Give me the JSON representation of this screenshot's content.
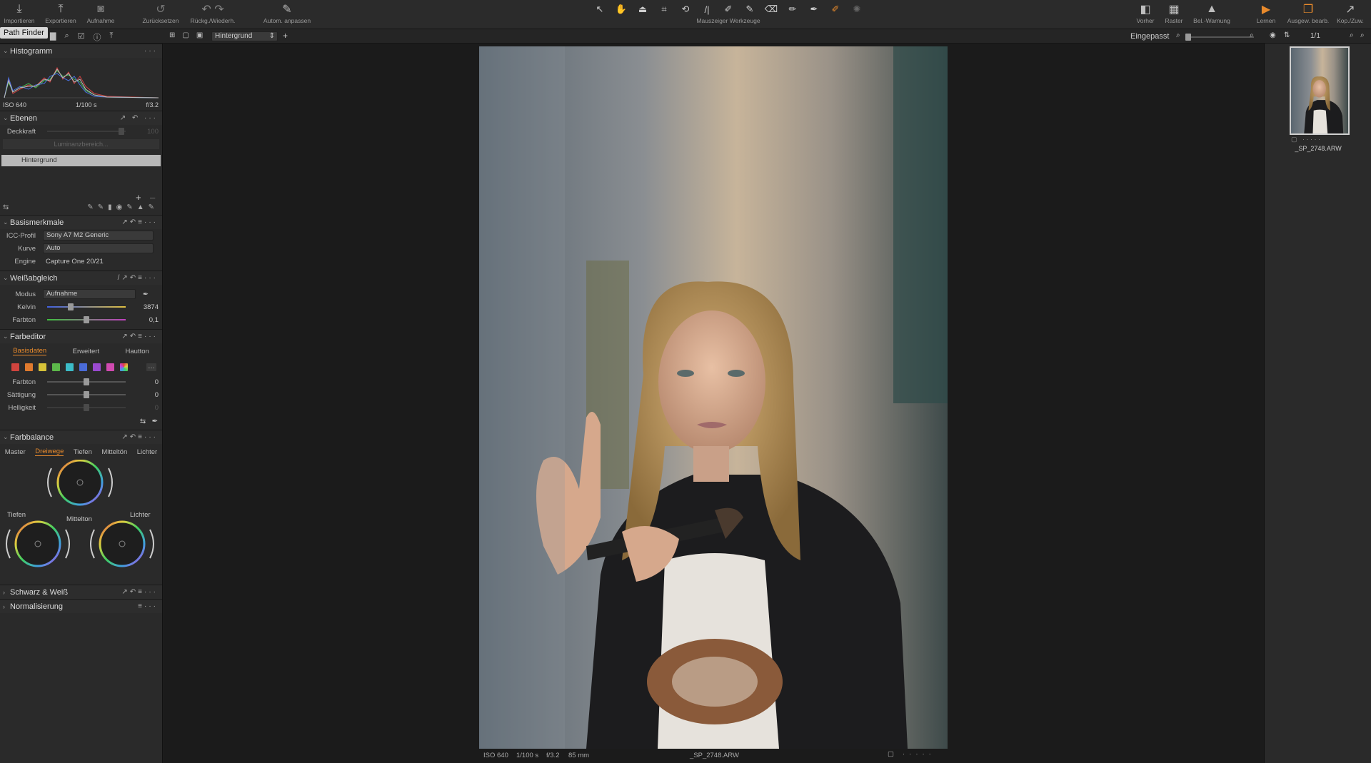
{
  "topbar": {
    "left_buttons": [
      {
        "label": "Importieren",
        "icon": "import-icon"
      },
      {
        "label": "Exportieren",
        "icon": "export-icon"
      },
      {
        "label": "Aufnahme",
        "icon": "camera-icon"
      },
      {
        "label": "Zurücksetzen",
        "icon": "reset-icon"
      },
      {
        "label": "Rückg./Wiederh.",
        "icon": "undo-redo-icon"
      },
      {
        "label": "Autom. anpassen",
        "icon": "auto-adjust-icon"
      }
    ],
    "center_label": "Mauszeiger Werkzeuge",
    "right_buttons": [
      {
        "label": "Vorher",
        "icon": "before-icon"
      },
      {
        "label": "Raster",
        "icon": "grid-icon"
      },
      {
        "label": "Bel.-Warnung",
        "icon": "warning-icon"
      },
      {
        "label": "Lernen",
        "icon": "learn-icon"
      },
      {
        "label": "Ausgew. bearb.",
        "icon": "edit-selected-icon"
      },
      {
        "label": "Kop./Zuw.",
        "icon": "copy-apply-icon"
      }
    ]
  },
  "subbar": {
    "layer_select": "Hintergrund",
    "fit_label": "Eingepasst",
    "counter": "1/1"
  },
  "tooltip": "Path Finder",
  "histogram": {
    "title": "Histogramm",
    "iso": "ISO 640",
    "shutter": "1/100 s",
    "aperture": "f/3.2"
  },
  "ebenen": {
    "title": "Ebenen",
    "opacity_label": "Deckkraft",
    "opacity_value": "100",
    "luminance_btn": "Luminanzbereich...",
    "layer_name": "Hintergrund"
  },
  "basismerkmale": {
    "title": "Basismerkmale",
    "icc_label": "ICC-Profil",
    "icc_value": "Sony A7 M2 Generic",
    "curve_label": "Kurve",
    "curve_value": "Auto",
    "engine_label": "Engine",
    "engine_value": "Capture One 20/21"
  },
  "weissabgleich": {
    "title": "Weißabgleich",
    "mode_label": "Modus",
    "mode_value": "Aufnahme",
    "kelvin_label": "Kelvin",
    "kelvin_value": "3874",
    "kelvin_level": 0.28,
    "tint_label": "Farbton",
    "tint_value": "0,1",
    "tint_level": 0.5
  },
  "farbeditor": {
    "title": "Farbeditor",
    "tabs": [
      "Basisdaten",
      "Erweitert",
      "Hautton"
    ],
    "active_tab": 0,
    "swatch_colors": [
      "#d0443e",
      "#e07a2e",
      "#d6c238",
      "#5cb84a",
      "#3cbcc8",
      "#4a6bd8",
      "#9a4ad0",
      "#d04ab0"
    ],
    "hue_label": "Farbton",
    "hue_value": "0",
    "sat_label": "Sättigung",
    "sat_value": "0",
    "bright_label": "Helligkeit",
    "bright_value": "0"
  },
  "farbbalance": {
    "title": "Farbbalance",
    "tabs": [
      "Master",
      "Dreiwege",
      "Tiefen",
      "Mitteltön",
      "Lichter"
    ],
    "active_tab": 1,
    "wheel_labels": {
      "shadows": "Tiefen",
      "mid": "Mittelton",
      "highlights": "Lichter"
    }
  },
  "collapsed": [
    {
      "title": "Schwarz & Weiß"
    },
    {
      "title": "Normalisierung"
    }
  ],
  "thumbnail": {
    "filename": "_SP_2748.ARW"
  },
  "infobar": {
    "iso": "ISO 640",
    "shutter": "1/100 s",
    "aperture": "f/3.2",
    "focal": "85 mm",
    "filename": "_SP_2748.ARW"
  },
  "colors": {
    "accent": "#e88a2c",
    "panel": "#2a2a2a",
    "viewer": "#1b1b1b"
  }
}
